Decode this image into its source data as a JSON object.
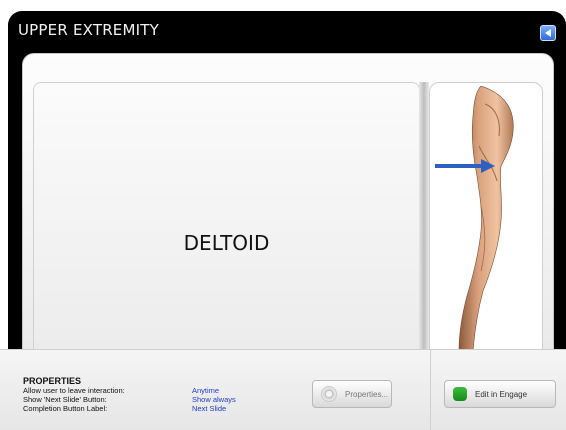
{
  "slide": {
    "title": "UPPER EXTREMITY",
    "term": "DELTOID"
  },
  "properties": {
    "heading": "PROPERTIES",
    "rows": [
      {
        "label": "Allow user to leave interaction:",
        "value": "Anytime"
      },
      {
        "label": "Show 'Next Slide' Button:",
        "value": "Show always"
      },
      {
        "label": "Completion Button Label:",
        "value": "Next Slide"
      }
    ]
  },
  "buttons": {
    "properties_label": "Properties...",
    "engage_label": "Edit in Engage"
  },
  "colors": {
    "value_text": "#1a3ccf",
    "title_bar": "#000000",
    "nav_button": "#3f7ee8",
    "engage_icon": "#2aa52a"
  },
  "icons": [
    "nav-back-icon",
    "arrow-pointer-icon",
    "properties-gear-icon",
    "engage-icon"
  ]
}
